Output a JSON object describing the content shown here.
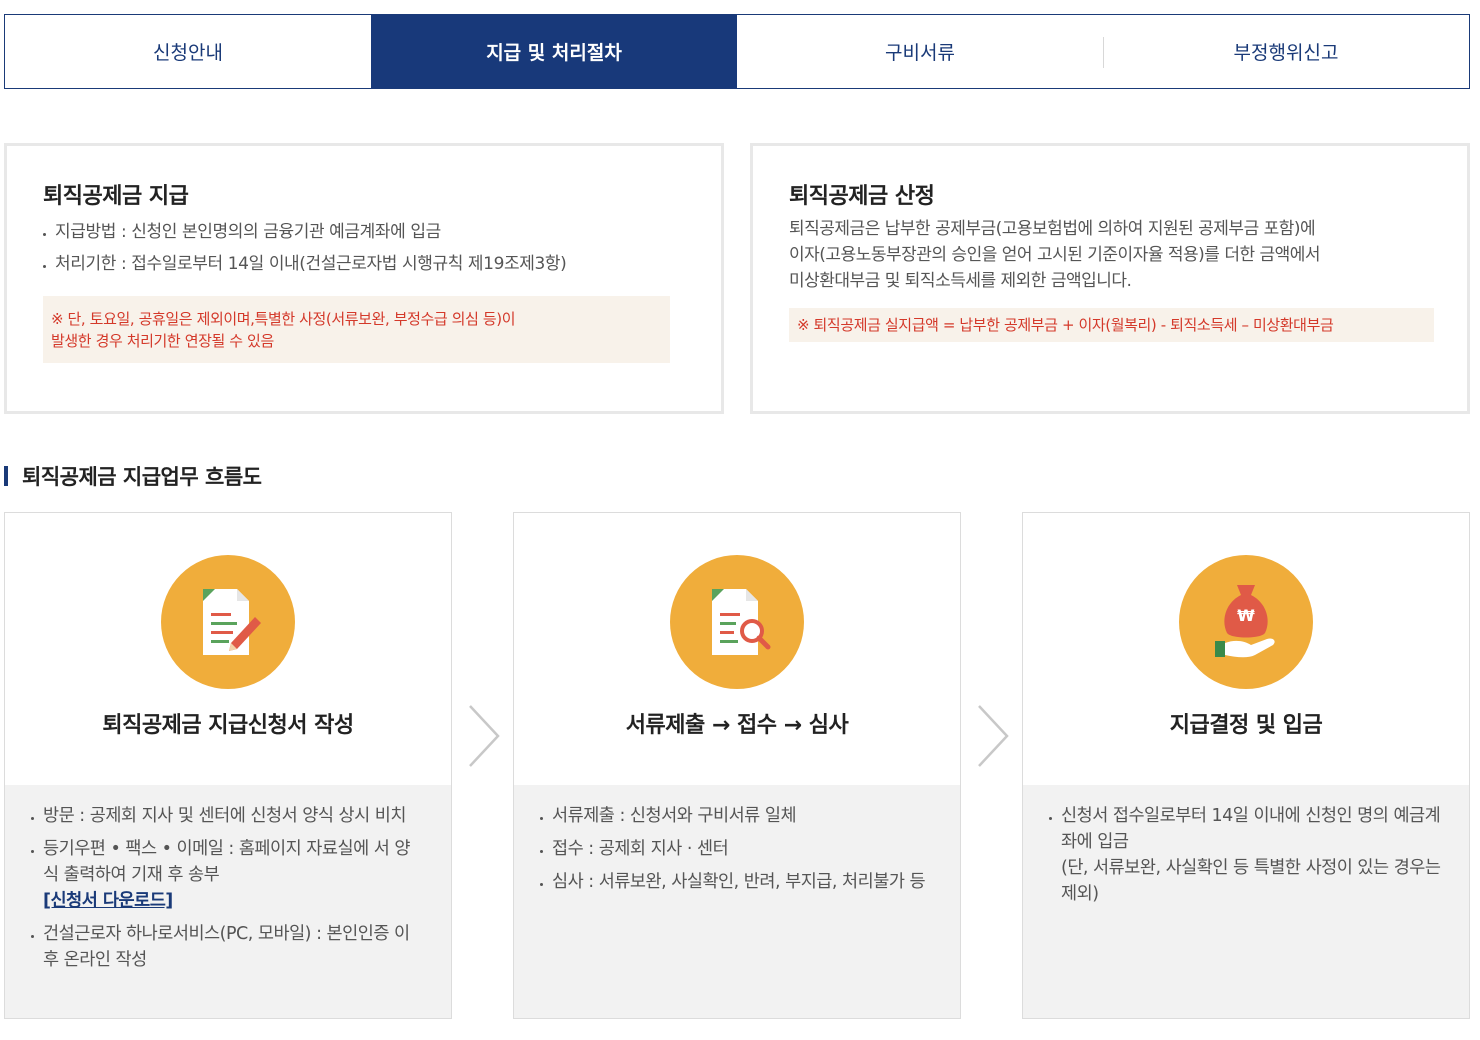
{
  "tabs": [
    {
      "label": "신청안내",
      "active": false
    },
    {
      "label": "지급 및 처리절차",
      "active": true
    },
    {
      "label": "구비서류",
      "active": false
    },
    {
      "label": "부정행위신고",
      "active": false
    }
  ],
  "payment_box": {
    "title": "퇴직공제금 지급",
    "items": [
      "지급방법 : 신청인 본인명의의 금융기관 예금계좌에 입금",
      "처리기한 : 접수일로부터 14일 이내(건설근로자법 시행규칙 제19조제3항)"
    ],
    "note_line1": "※ 단, 토요일, 공휴일은 제외이며,특별한 사정(서류보완, 부정수급 의심 등)이",
    "note_line2": "발생한 경우 처리기한 연장될 수 있음"
  },
  "calc_box": {
    "title": "퇴직공제금 산정",
    "desc_line1": "퇴직공제금은 납부한 공제부금(고용보험법에 의하여 지원된 공제부금 포함)에",
    "desc_line2": "이자(고용노동부장관의 승인을 얻어 고시된 기준이자율 적용)를 더한 금액에서",
    "desc_line3": "미상환대부금 및 퇴직소득세를 제외한 금액입니다.",
    "note": "※ 퇴직공제금 실지급액 = 납부한 공제부금 + 이자(월복리) - 퇴직소득세 – 미상환대부금"
  },
  "flow": {
    "title": "퇴직공제금 지급업무 흐름도",
    "steps": [
      {
        "icon": "document-write-icon",
        "title": "퇴직공제금 지급신청서 작성",
        "items": [
          "방문 : 공제회 지사 및 센터에 신청서 양식 상시 비치",
          "등기우편 • 팩스 • 이메일 : 홈페이지 자료실에 서 양식 출력하여 기재 후 송부",
          "건설근로자 하나로서비스(PC, 모바일) : 본인인증 이후 온라인 작성"
        ],
        "download_link": "[신청서 다운로드]"
      },
      {
        "icon": "document-search-icon",
        "title": "서류제출 → 접수 → 심사",
        "items": [
          "서류제출 : 신청서와 구비서류 일체",
          "접수 : 공제회 지사 · 센터",
          "심사 : 서류보완, 사실확인, 반려, 부지급, 처리불가 등"
        ]
      },
      {
        "icon": "money-bag-hand-icon",
        "title": "지급결정 및 입금",
        "items": [
          "신청서 접수일로부터 14일 이내에 신청인 명의 예금계좌에 입금",
          "(단, 서류보완, 사실확인 등 특별한 사정이 있는 경우는 제외)"
        ]
      }
    ]
  },
  "colors": {
    "navy": "#18397a",
    "orange": "#f0ad3b",
    "note_red": "#d4392a",
    "note_bg": "#f8f2ea"
  }
}
